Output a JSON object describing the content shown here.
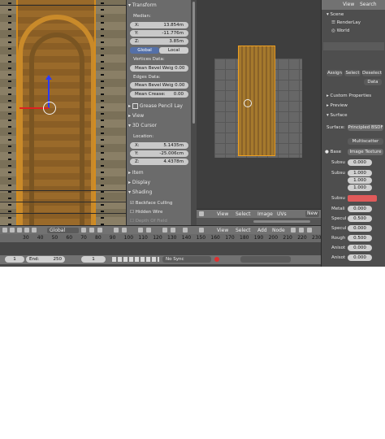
{
  "transform_panel": {
    "title": "Transform",
    "median_label": "Median:",
    "x": "X:",
    "x_val": "13.854m",
    "y": "Y:",
    "y_val": "-11.776m",
    "z": "Z:",
    "z_val": "3.85m",
    "global": "Global",
    "local": "Local",
    "vertices_data": "Vertices Data:",
    "mean_bevel_weig_1": "Mean Bevel Weig 0.00",
    "edges_data": "Edges Data:",
    "mean_bevel_weig_2": "Mean Bevel Weig 0.00",
    "mean_crease": "Mean Crease:",
    "mean_crease_val": "0.00",
    "grease_pencil": "Grease Pencil Lay",
    "view": "View",
    "cursor": "3D Cursor",
    "location": "Location:",
    "cx": "X:",
    "cx_val": "5.1435m",
    "cy": "Y:",
    "cy_val": "-25.006cm",
    "cz": "Z:",
    "cz_val": "4.4378m",
    "item": "Item",
    "display": "Display",
    "shading": "Shading",
    "backface": "Backface Culling",
    "hidden_wire": "Hidden Wire",
    "depth_of_field": "Depth Of Field"
  },
  "viewport_header": {
    "orientation": "Global"
  },
  "uv_header": {
    "view": "View",
    "select": "Select",
    "image": "Image",
    "uvs": "UVs",
    "new": "New"
  },
  "node_header": {
    "view": "View",
    "select": "Select",
    "add": "Add",
    "node": "Node"
  },
  "outliner": {
    "view": "View",
    "search": "Search",
    "scene": "Scene",
    "render_layers": "RenderLay",
    "world": "World"
  },
  "material": {
    "assign": "Assign",
    "select": "Select",
    "deselect": "Deselect",
    "data": "Data",
    "custom_properties": "Custom Properties",
    "preview": "Preview",
    "surface_section": "Surface",
    "surface_label": "Surface:",
    "surface_value": "Principled BSDF",
    "multiscatter": "Multiscatter",
    "base": "Base",
    "image_texture": "Image Texture",
    "subsu1": "Subsu",
    "subsu1_val": "0.000",
    "subsu2": "Subsu",
    "subsu2_vals": [
      "1.000",
      "1.000",
      "1.000"
    ],
    "subsu3": "Subsu",
    "metal": "Metali",
    "metal_val": "0.000",
    "specu1": "Specul",
    "specu1_val": "0.500",
    "specu2": "Specul",
    "specu2_val": "0.000",
    "rough": "Rough",
    "rough_val": "0.500",
    "aniso1": "Anisot",
    "aniso1_val": "0.000",
    "aniso2": "Anisot",
    "aniso2_val": "0.000",
    "subsurface_color": "#e05a5a"
  },
  "timeline": {
    "ticks": [
      "30",
      "40",
      "50",
      "60",
      "70",
      "80",
      "90",
      "100",
      "110",
      "120",
      "130",
      "140",
      "150",
      "160",
      "170",
      "180",
      "190",
      "200",
      "210",
      "220",
      "230"
    ],
    "start_val": "1",
    "end_label": "End:",
    "end_val": "250",
    "current": "1",
    "sync": "No Sync"
  },
  "colors": {
    "selection": "#f0a020",
    "panel_bg": "#6b6b6b"
  }
}
